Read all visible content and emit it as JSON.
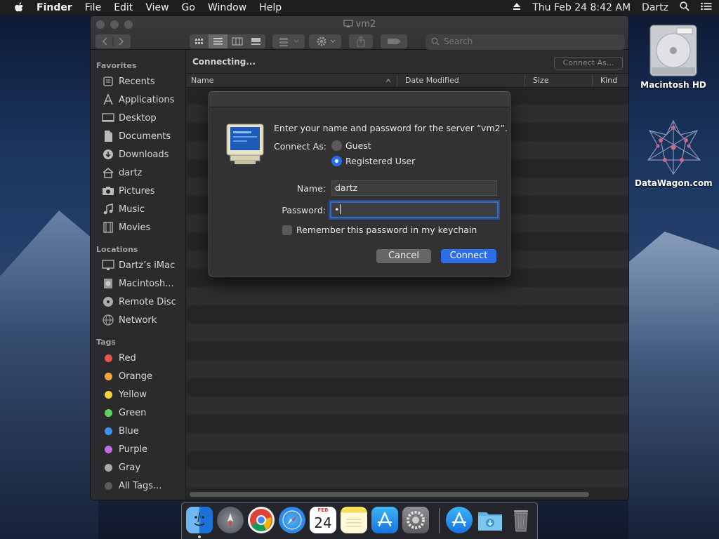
{
  "menubar": {
    "app": "Finder",
    "items": [
      "File",
      "Edit",
      "View",
      "Go",
      "Window",
      "Help"
    ],
    "datetime": "Thu Feb 24  8:42 AM",
    "user": "Dartz"
  },
  "desktop": {
    "icons": [
      {
        "label": "Macintosh HD",
        "icon": "hard-drive-icon"
      },
      {
        "label": "DataWagon.com",
        "icon": "network-server-icon"
      }
    ]
  },
  "window": {
    "title": "vm2",
    "search_placeholder": "Search",
    "status": "Connecting...",
    "connect_as_button": "Connect As...",
    "columns": [
      "Name",
      "Date Modified",
      "Size",
      "Kind"
    ]
  },
  "sidebar": {
    "favorites_header": "Favorites",
    "favorites": [
      {
        "label": "Recents",
        "icon": "clock-icon"
      },
      {
        "label": "Applications",
        "icon": "applications-icon"
      },
      {
        "label": "Desktop",
        "icon": "desktop-icon"
      },
      {
        "label": "Documents",
        "icon": "document-icon"
      },
      {
        "label": "Downloads",
        "icon": "download-icon"
      },
      {
        "label": "dartz",
        "icon": "home-icon"
      },
      {
        "label": "Pictures",
        "icon": "camera-icon"
      },
      {
        "label": "Music",
        "icon": "music-note-icon"
      },
      {
        "label": "Movies",
        "icon": "film-icon"
      }
    ],
    "locations_header": "Locations",
    "locations": [
      {
        "label": "Dartz’s iMac",
        "icon": "imac-icon"
      },
      {
        "label": "Macintosh...",
        "icon": "disk-icon"
      },
      {
        "label": "Remote Disc",
        "icon": "cd-icon"
      },
      {
        "label": "Network",
        "icon": "globe-icon"
      }
    ],
    "tags_header": "Tags",
    "tags": [
      {
        "label": "Red",
        "color": "#e9534c"
      },
      {
        "label": "Orange",
        "color": "#f3a33b"
      },
      {
        "label": "Yellow",
        "color": "#f4d43a"
      },
      {
        "label": "Green",
        "color": "#5bd65b"
      },
      {
        "label": "Blue",
        "color": "#3b92f4"
      },
      {
        "label": "Purple",
        "color": "#c26be6"
      },
      {
        "label": "Gray",
        "color": "#a9a9ab"
      },
      {
        "label": "All Tags...",
        "color": "#5a5a5c"
      }
    ]
  },
  "dialog": {
    "prompt": "Enter your name and password for the server “vm2”.",
    "connect_as_label": "Connect As:",
    "option_guest": "Guest",
    "option_registered": "Registered User",
    "selected_option": "Registered User",
    "name_label": "Name:",
    "name_value": "dartz",
    "password_label": "Password:",
    "password_value": "•",
    "remember_label": "Remember this password in my keychain",
    "remember_checked": false,
    "cancel_button": "Cancel",
    "connect_button": "Connect",
    "accent_color": "#2b6ee8"
  },
  "dock": {
    "apps": [
      "finder-icon",
      "launchpad-icon",
      "chrome-icon",
      "safari-icon",
      "calendar-icon",
      "notes-icon",
      "app-store-icon",
      "system-preferences-icon",
      "app-store-icon",
      "downloads-folder-icon",
      "trash-icon"
    ],
    "calendar_month": "FEB",
    "calendar_day": "24"
  }
}
